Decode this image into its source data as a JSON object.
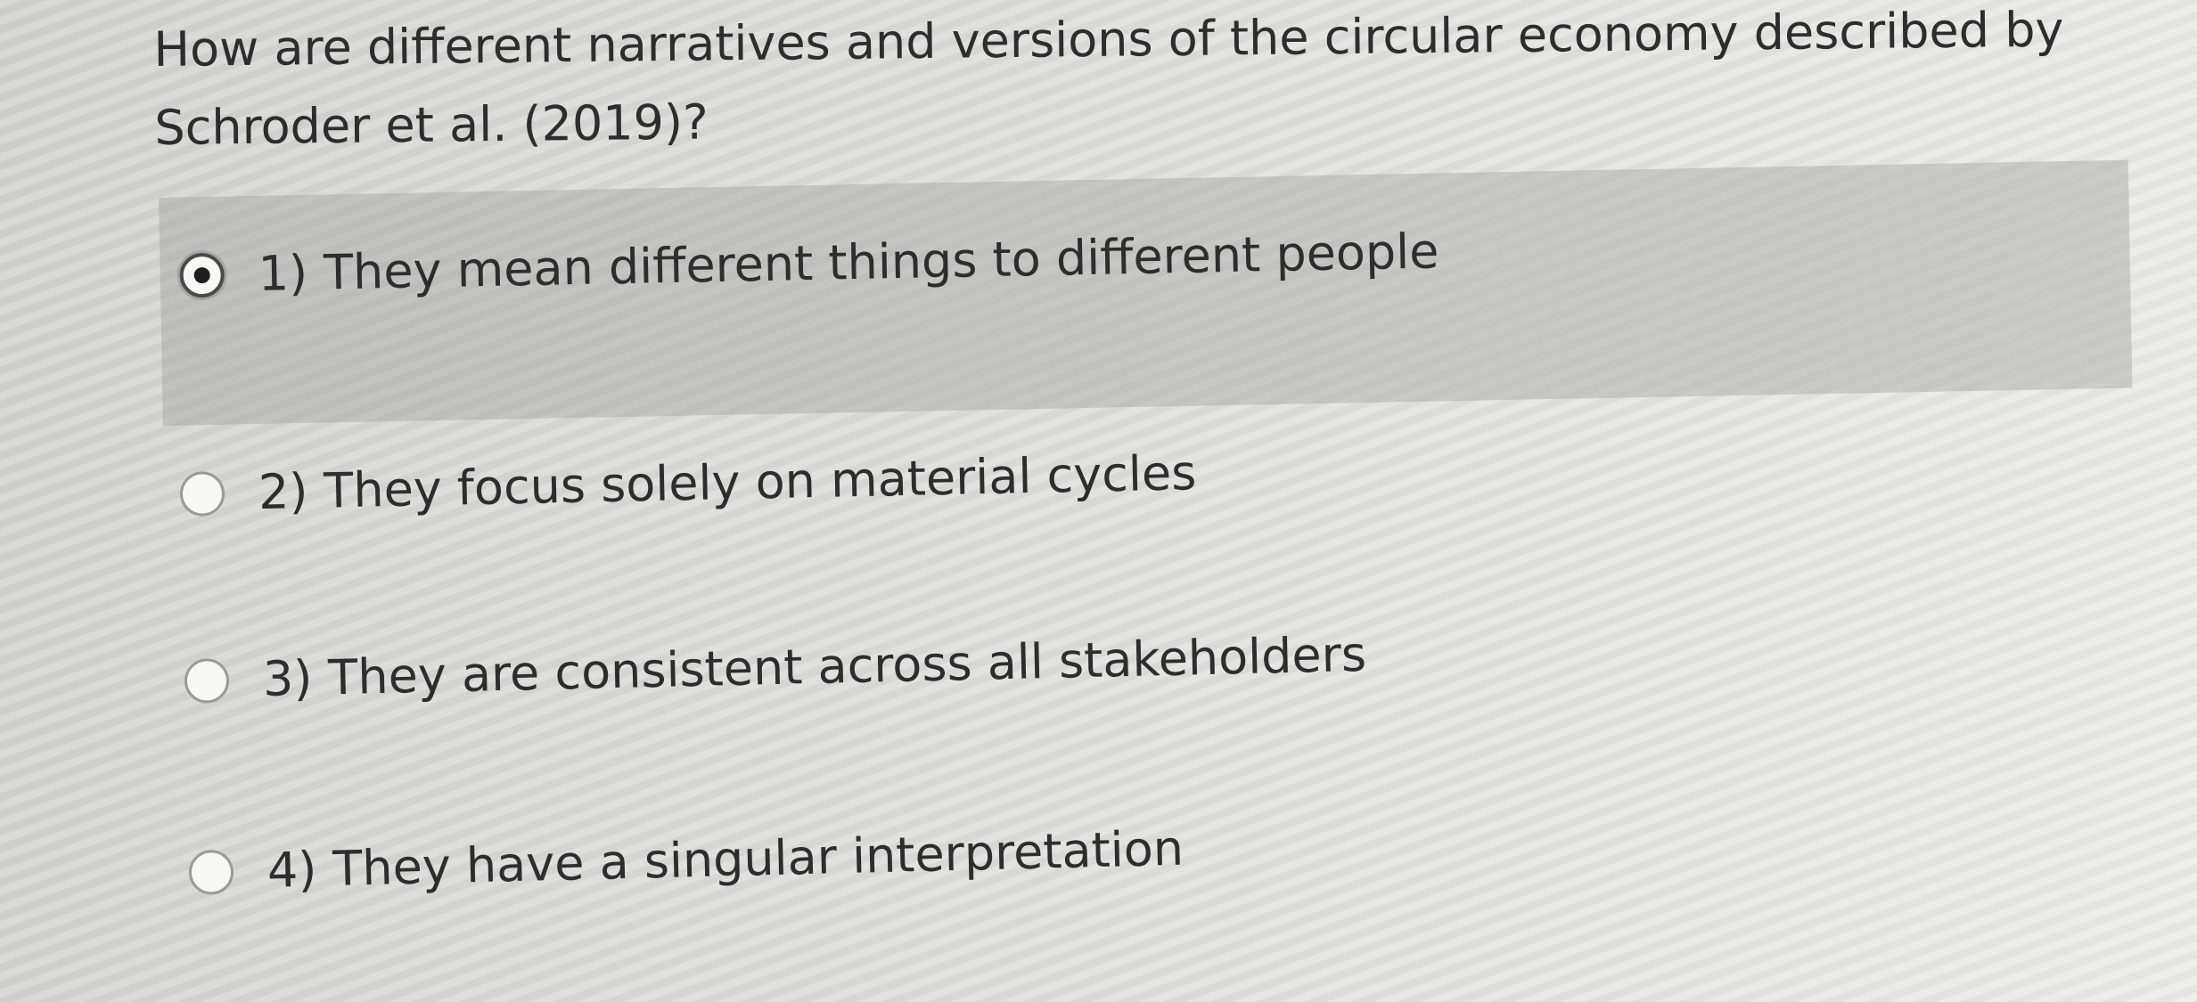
{
  "question": {
    "line1": "How are different narratives and versions of the circular economy described by",
    "line2": "Schroder et al. (2019)?"
  },
  "options": [
    {
      "number": "1)",
      "text": "They mean different things to different people",
      "selected": true
    },
    {
      "number": "2)",
      "text": "They focus solely on material cycles",
      "selected": false
    },
    {
      "number": "3)",
      "text": "They are consistent across all stakeholders",
      "selected": false
    },
    {
      "number": "4)",
      "text": "They have a singular interpretation",
      "selected": false
    }
  ],
  "colors": {
    "selected_row_bg": "#b2b2b0",
    "text": "#2d2d2d"
  }
}
